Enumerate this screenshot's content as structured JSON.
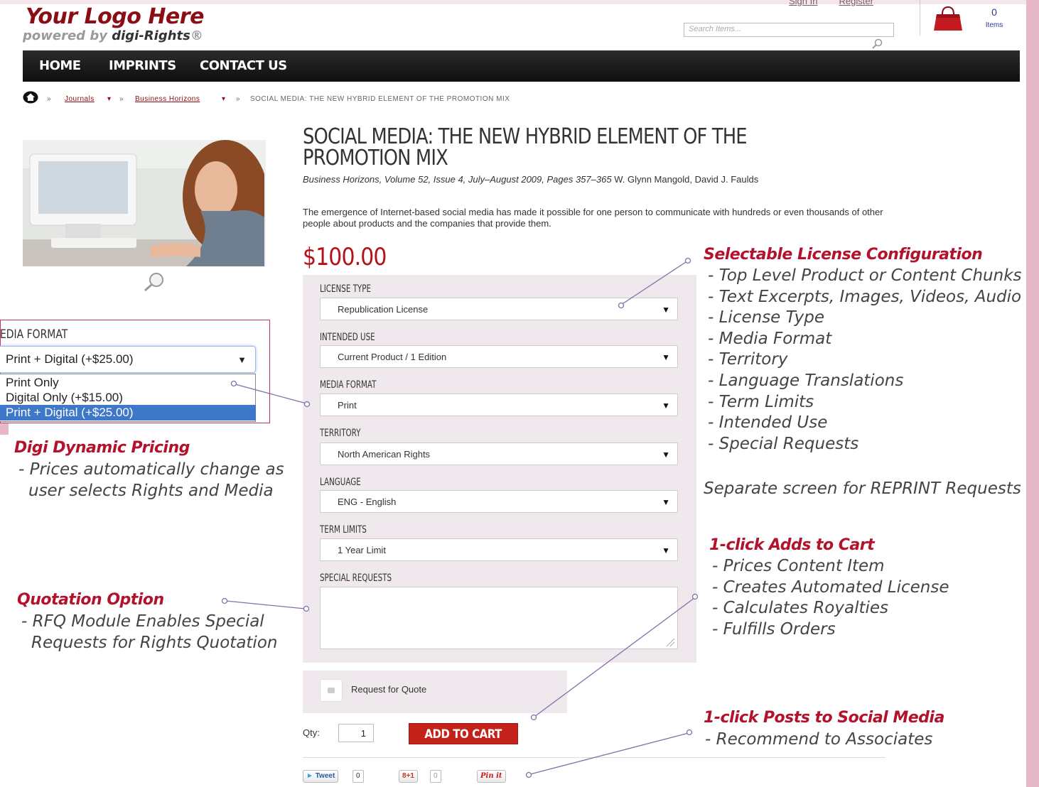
{
  "header": {
    "logo_main": "Your Logo Here",
    "logo_sub_prefix": "powered by ",
    "logo_sub_brand": "digi-Rights",
    "logo_sub_suffix": "®",
    "sign_in": "Sign In",
    "register": "Register",
    "search_placeholder": "Search Items...",
    "cart_count": "0",
    "cart_label": "Items"
  },
  "nav": {
    "items": [
      "HOME",
      "IMPRINTS",
      "CONTACT US"
    ]
  },
  "breadcrumb": {
    "journals": "Journals",
    "business_horizons": "Business Horizons",
    "current": "SOCIAL MEDIA: THE NEW HYBRID ELEMENT OF THE PROMOTION MIX",
    "separator": "»",
    "caret": "▾"
  },
  "product": {
    "title": "SOCIAL MEDIA: THE NEW HYBRID ELEMENT OF THE PROMOTION MIX",
    "citation_journal": "Business Horizons, Volume 52, Issue 4, July–August 2009, Pages 357–365",
    "citation_authors": " W. Glynn Mangold, David J. Faulds",
    "abstract": "The emergence of Internet-based social media has made it possible for one person to communicate with hundreds or even thousands of other people about products and the companies that provide them.",
    "price": "$100.00"
  },
  "options": {
    "license_type": {
      "label": "LICENSE TYPE",
      "value": "Republication License"
    },
    "intended_use": {
      "label": "INTENDED USE",
      "value": "Current Product / 1 Edition"
    },
    "media_format": {
      "label": "MEDIA FORMAT",
      "value": "Print"
    },
    "territory": {
      "label": "TERRITORY",
      "value": "North American Rights"
    },
    "language": {
      "label": "LANGUAGE",
      "value": "ENG - English"
    },
    "term_limits": {
      "label": "TERM LIMITS",
      "value": "1 Year Limit"
    },
    "special_requests": {
      "label": "SPECIAL REQUESTS",
      "value": ""
    },
    "arrow": "▼"
  },
  "rfq": {
    "label": "Request for Quote"
  },
  "cart": {
    "qty_label": "Qty:",
    "qty_value": "1",
    "add_button": "ADD TO CART"
  },
  "social": {
    "tweet": "Tweet",
    "tweet_count": "0",
    "gplus": "+1",
    "gplus_count": "0",
    "pinit": "Pin it"
  },
  "popup": {
    "label": "EDIA FORMAT",
    "selected": "Print + Digital (+$25.00)",
    "options": [
      "Print Only",
      "Digital Only (+$15.00)",
      "Print + Digital (+$25.00)"
    ],
    "arrow": "▼"
  },
  "annotations": {
    "license_config": {
      "heading": "Selectable License Configuration",
      "items": [
        "- Top Level Product or Content Chunks",
        "- Text Excerpts, Images, Videos, Audio",
        "- License Type",
        "- Media Format",
        "- Territory",
        "- Language Translations",
        "- Term Limits",
        "- Intended Use",
        "- Special Requests"
      ],
      "note": "Separate screen for REPRINT Requests"
    },
    "dynamic_pricing": {
      "heading": "Digi Dynamic Pricing",
      "line1": "- Prices automatically change as",
      "line2": "user selects Rights and Media"
    },
    "quotation": {
      "heading": "Quotation Option",
      "line1": "- RFQ Module Enables Special",
      "line2": "Requests for Rights Quotation"
    },
    "add_to_cart": {
      "heading": "1-click Adds to Cart",
      "items": [
        "- Prices Content Item",
        "- Creates Automated License",
        "- Calculates Royalties",
        "- Fulfills Orders"
      ]
    },
    "social_media": {
      "heading": "1-click Posts to Social Media",
      "line1": "- Recommend to Associates"
    }
  },
  "colors": {
    "accent_red": "#b3121a",
    "annotation_red": "#b3122c",
    "panel_bg": "#efe9ed",
    "frame_pink": "#e7b8c7",
    "callout_line": "#8070a8"
  }
}
